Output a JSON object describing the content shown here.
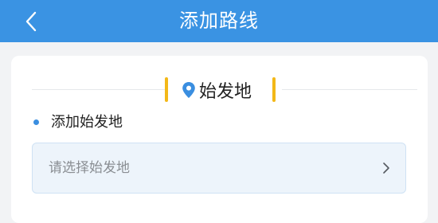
{
  "header": {
    "title": "添加路线",
    "back_icon": "chevron-left-icon",
    "background": "#3a93e3"
  },
  "section": {
    "title": "始发地",
    "icon": "location-pin-icon",
    "accent_color": "#f3b818",
    "pin_color": "#3a8ee0"
  },
  "origin": {
    "add_label": "添加始发地",
    "field_placeholder": "请选择始发地",
    "chevron_icon": "chevron-right-icon"
  }
}
